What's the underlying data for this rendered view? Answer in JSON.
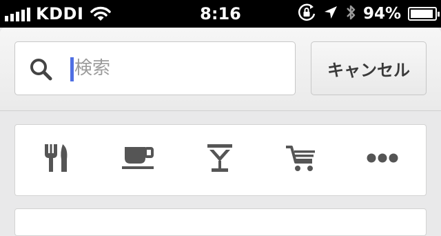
{
  "status_bar": {
    "carrier": "KDDI",
    "time": "8:16",
    "battery_percent": "94%",
    "battery_level": 0.94,
    "icons": [
      "signal-icon",
      "wifi-icon",
      "rotation-lock-icon",
      "location-arrow-icon",
      "bluetooth-icon",
      "battery-icon"
    ]
  },
  "search": {
    "placeholder": "検索",
    "value": "",
    "cancel_label": "キャンセル"
  },
  "categories": [
    {
      "icon": "fork-knife-icon"
    },
    {
      "icon": "coffee-cup-icon"
    },
    {
      "icon": "cocktail-icon"
    },
    {
      "icon": "shopping-cart-icon"
    },
    {
      "icon": "more-icon"
    }
  ],
  "colors": {
    "status_bar_bg": "#000000",
    "icon_gray": "#555555",
    "caret_blue": "#4f6fe3",
    "background": "#e9e9ea"
  }
}
